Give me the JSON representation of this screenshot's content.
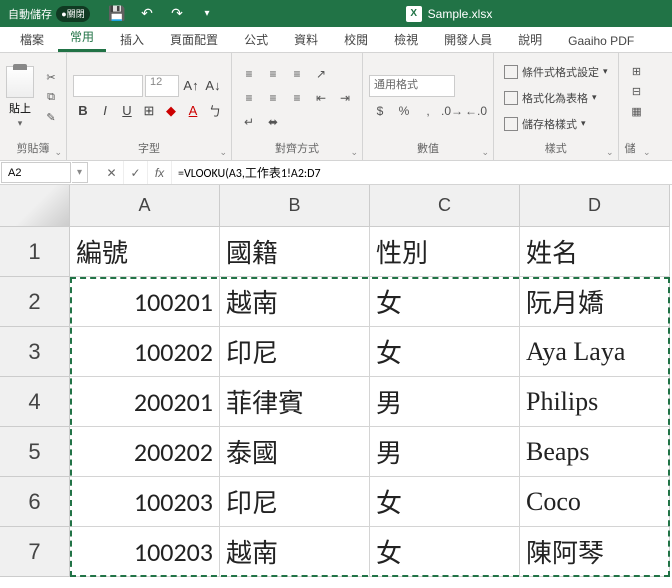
{
  "titlebar": {
    "autosave_label": "自動儲存",
    "autosave_state": "●關閉",
    "filename": "Sample.xlsx"
  },
  "tabs": {
    "file": "檔案",
    "home": "常用",
    "insert": "插入",
    "layout": "頁面配置",
    "formulas": "公式",
    "data": "資料",
    "review": "校閱",
    "view": "檢視",
    "developer": "開發人員",
    "help": "說明",
    "gaaiho": "Gaaiho PDF"
  },
  "ribbon": {
    "clipboard_paste": "貼上",
    "clipboard_group": "剪貼簿",
    "font_size": "12",
    "font_group": "字型",
    "align_group": "對齊方式",
    "number_format": "通用格式",
    "number_group": "數值",
    "styles_cond": "條件式格式設定",
    "styles_table": "格式化為表格",
    "styles_cell": "儲存格樣式",
    "styles_group": "樣式",
    "cells_partial": "儲"
  },
  "formula_bar": {
    "namebox": "A2",
    "formula": "=VLOOKU(A3,工作表1!A2:D7"
  },
  "columns": {
    "a": "A",
    "b": "B",
    "c": "C",
    "d": "D"
  },
  "rownums": [
    "1",
    "2",
    "3",
    "4",
    "5",
    "6",
    "7"
  ],
  "headers": {
    "a": "編號",
    "b": "國籍",
    "c": "性別",
    "d": "姓名"
  },
  "rows": [
    {
      "id": "100201",
      "nat": "越南",
      "sex": "女",
      "name": "阮月嬌"
    },
    {
      "id": "100202",
      "nat": "印尼",
      "sex": "女",
      "name": "Aya Laya"
    },
    {
      "id": "200201",
      "nat": "菲律賓",
      "sex": "男",
      "name": "Philips"
    },
    {
      "id": "200202",
      "nat": "泰國",
      "sex": "男",
      "name": "Beaps"
    },
    {
      "id": "100203",
      "nat": "印尼",
      "sex": "女",
      "name": "Coco"
    },
    {
      "id": "100203",
      "nat": "越南",
      "sex": "女",
      "name": "陳阿琴"
    }
  ]
}
